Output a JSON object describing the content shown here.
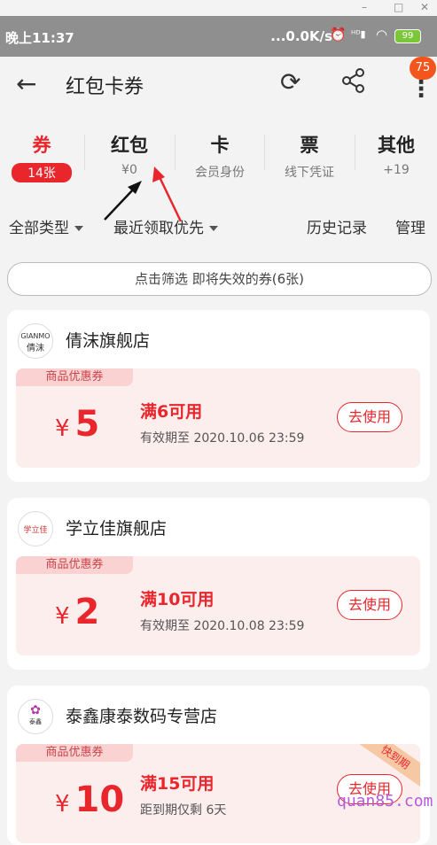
{
  "window": {
    "minimize": "–",
    "maximize": "□",
    "close": "✕"
  },
  "status": {
    "time": "晚上11:37",
    "speed": "...0.0K/s",
    "battery": "99",
    "icons": [
      "alarm-icon",
      "hd-signal-icon",
      "wifi-icon",
      "battery-icon"
    ]
  },
  "appbar": {
    "back_icon": "←",
    "title": "红包卡券",
    "refresh_icon": "⟳",
    "more_icon": "⋮",
    "badge": "75"
  },
  "tabs": [
    {
      "title": "券",
      "sub": "14张"
    },
    {
      "title": "红包",
      "sub": "¥0"
    },
    {
      "title": "卡",
      "sub": "会员身份"
    },
    {
      "title": "票",
      "sub": "线下凭证"
    },
    {
      "title": "其他",
      "sub": "+19"
    }
  ],
  "filters": {
    "type": "全部类型",
    "sort": "最近领取优先",
    "history": "历史记录",
    "manage": "管理"
  },
  "notice": "点击筛选 即将失效的券(6张)",
  "cards": [
    {
      "shop": "倩沫旗舰店",
      "logo_text": "GIANMO",
      "logo_sub": "倩沫",
      "tag": "商品优惠券",
      "currency": "¥",
      "amount": "5",
      "condition": "满6可用",
      "validity": "有效期至 2020.10.06 23:59",
      "button": "去使用"
    },
    {
      "shop": "学立佳旗舰店",
      "logo_text": "学立佳",
      "tag": "商品优惠券",
      "currency": "¥",
      "amount": "2",
      "condition": "满10可用",
      "validity": "有效期至 2020.10.08 23:59",
      "button": "去使用"
    },
    {
      "shop": "泰鑫康泰数码专营店",
      "logo_text": "泰鑫",
      "tag": "商品优惠券",
      "currency": "¥",
      "amount": "10",
      "condition": "满15可用",
      "validity": "距到期仅剩 6天",
      "button": "去使用",
      "ribbon": "快到期"
    }
  ],
  "watermark": "quan85.com",
  "colors": {
    "accent": "#e8262c",
    "badge": "#f2561d",
    "battery": "#7cc63b"
  }
}
